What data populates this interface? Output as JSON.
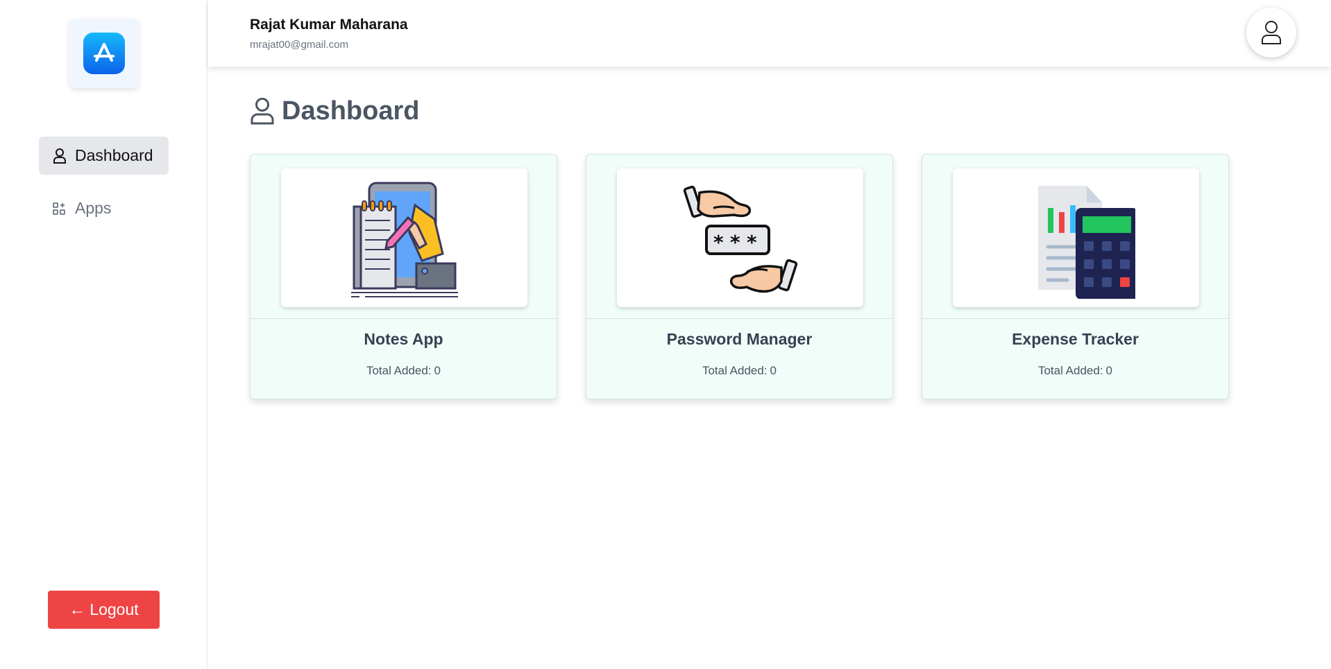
{
  "sidebar": {
    "logo_icon": "app-store-icon",
    "items": [
      {
        "label": "Dashboard",
        "icon": "user-icon",
        "active": true
      },
      {
        "label": "Apps",
        "icon": "grid-icon",
        "active": false
      }
    ],
    "logout_label": "Logout",
    "logout_icon": "arrow-left-icon"
  },
  "header": {
    "user_name": "Rajat Kumar Maharana",
    "user_email": "mrajat00@gmail.com",
    "avatar_icon": "user-icon"
  },
  "main": {
    "title": "Dashboard",
    "title_icon": "user-icon",
    "cards": [
      {
        "title": "Notes App",
        "count_label": "Total Added:",
        "count": "0",
        "icon": "notes-illustration"
      },
      {
        "title": "Password Manager",
        "count_label": "Total Added:",
        "count": "0",
        "icon": "password-illustration"
      },
      {
        "title": "Expense Tracker",
        "count_label": "Total Added:",
        "count": "0",
        "icon": "expense-illustration"
      }
    ]
  },
  "colors": {
    "accent": "#0a63ea",
    "logout": "#ef4444",
    "card_bg": "#f0fdf9",
    "active_nav": "#e5e7eb"
  }
}
